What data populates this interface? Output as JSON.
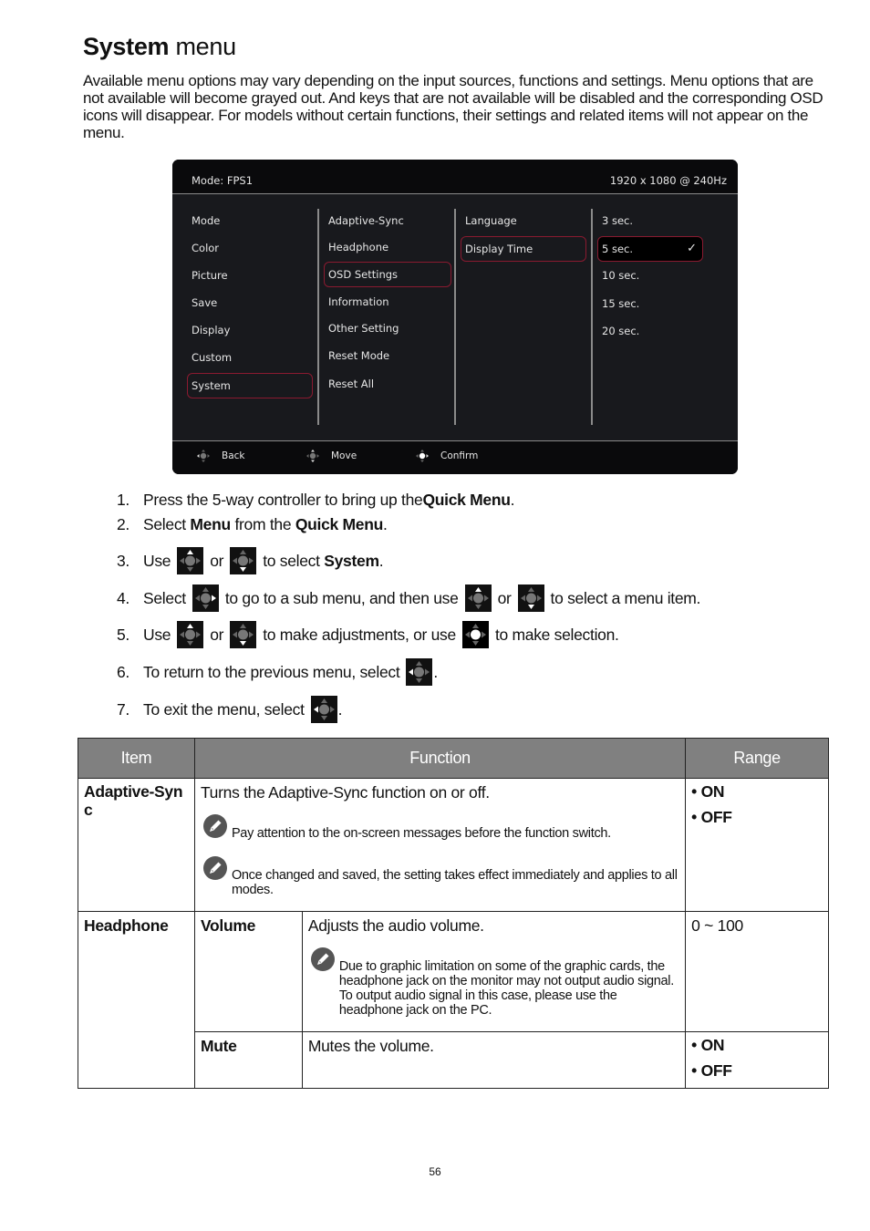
{
  "title": {
    "bold": "System",
    "rest": " menu"
  },
  "intro": "Available menu options may vary depending on the input sources, functions and settings. Menu options that are not available will become grayed out. And keys that are not available will be disabled and the corresponding OSD icons will disappear. For models without certain functions, their settings and related items will not appear on the menu.",
  "osd": {
    "mode": "Mode: FPS1",
    "resolution": "1920 x 1080 @ 240Hz",
    "col1": [
      "Mode",
      "Color",
      "Picture",
      "Save",
      "Display",
      "Custom",
      "System"
    ],
    "col1_selected": "System",
    "col2": [
      "Adaptive-Sync",
      "Headphone",
      "OSD Settings",
      "Information",
      "Other Setting",
      "Reset Mode",
      "Reset All"
    ],
    "col2_selected": "OSD Settings",
    "col3": [
      "Language",
      "Display Time"
    ],
    "col3_selected": "Display Time",
    "col4": [
      "3 sec.",
      "5 sec.",
      "10 sec.",
      "15 sec.",
      "20 sec."
    ],
    "col4_selected": "5 sec.",
    "col4_check_icon": "checkmark-icon",
    "footer": [
      {
        "label": "Back",
        "icon": "controller-left-icon"
      },
      {
        "label": "Move",
        "icon": "controller-updown-icon"
      },
      {
        "label": "Confirm",
        "icon": "controller-confirm-icon"
      }
    ],
    "colors": {
      "bg": "#18191d",
      "header": "#0a0a0c",
      "select_border": "#8a1a30",
      "text": "#e6e6e6"
    }
  },
  "steps": [
    {
      "num": "1.",
      "parts": [
        "Press the 5-way controller to bring up the ",
        "Quick Menu",
        "."
      ]
    },
    {
      "num": "2.",
      "parts": [
        "Select ",
        "Menu",
        " from the ",
        "Quick Menu",
        "."
      ]
    },
    {
      "num": "3.",
      "parts": [
        "Use",
        "or",
        "to select ",
        "System",
        "."
      ],
      "icons": [
        "controller-up-icon",
        "controller-down-icon"
      ]
    },
    {
      "num": "4.",
      "parts": [
        "Select",
        "to go to a sub menu, and then use",
        "or",
        "to select a menu item."
      ],
      "icons": [
        "controller-right-icon",
        "controller-up-icon",
        "controller-down-icon"
      ]
    },
    {
      "num": "5.",
      "parts": [
        "Use",
        "or",
        "to make adjustments, or use",
        "to make selection."
      ],
      "icons": [
        "controller-up-icon",
        "controller-down-icon",
        "controller-confirm-icon"
      ]
    },
    {
      "num": "6.",
      "parts": [
        "To return to the previous menu, select",
        "."
      ],
      "icons": [
        "controller-left-icon"
      ]
    },
    {
      "num": "7.",
      "parts": [
        "To exit the menu, select",
        "."
      ],
      "icons": [
        "controller-left-icon"
      ]
    }
  ],
  "table": {
    "headers": [
      "Item",
      "Function",
      "Range"
    ],
    "rows": [
      {
        "item": "Adaptive-Sync",
        "function": "Turns the Adaptive-Sync function on or off.",
        "notes": [
          "Pay attention to the on-screen messages before the function switch.",
          "Once changed and saved, the setting takes effect immediately and applies to all modes."
        ],
        "range": [
          "ON",
          "OFF"
        ]
      },
      {
        "item": "Headphone",
        "subrows": [
          {
            "subitem": "Volume",
            "function": "Adjusts the audio volume.",
            "notes": [
              "Due to graphic limitation on some of the graphic cards, the headphone jack on the monitor may not output audio signal. To output audio signal in this case, please use the headphone jack on the PC."
            ],
            "range": "0 ~ 100"
          },
          {
            "subitem": "Mute",
            "function": "Mutes the volume.",
            "range": [
              "ON",
              "OFF"
            ]
          }
        ]
      }
    ]
  },
  "page_number": "56"
}
